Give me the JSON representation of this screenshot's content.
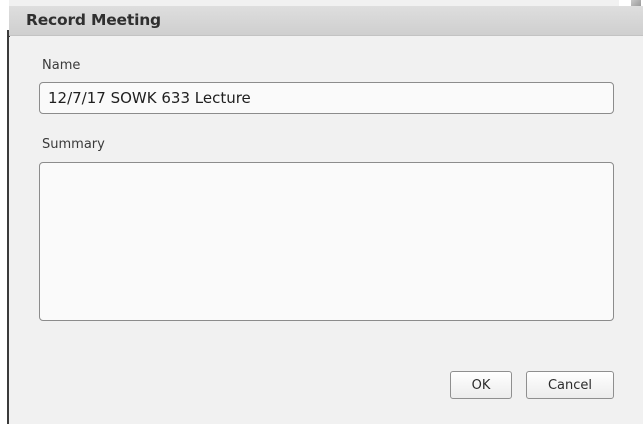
{
  "dialog": {
    "title": "Record Meeting",
    "name_label": "Name",
    "name_value": "12/7/17 SOWK 633 Lecture",
    "summary_label": "Summary",
    "summary_value": "",
    "ok_label": "OK",
    "cancel_label": "Cancel"
  },
  "colors": {
    "titlebar": "#d6d6d6",
    "background": "#f1f1f1",
    "input_border": "#8c8c8c"
  }
}
